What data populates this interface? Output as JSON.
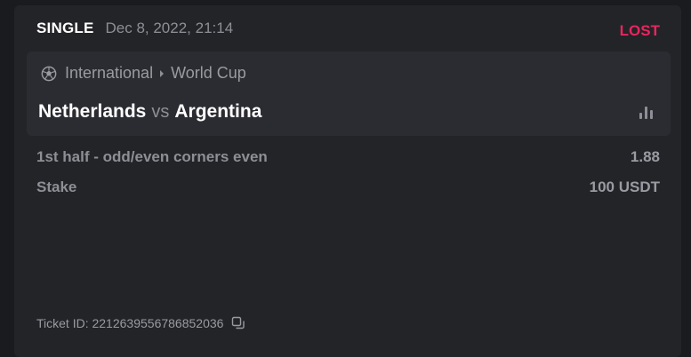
{
  "bet": {
    "type": "SINGLE",
    "date": "Dec 8, 2022, 21:14",
    "status": "LOST",
    "status_color": "#e8265e"
  },
  "event": {
    "sport_icon": "soccer-ball-icon",
    "category": "International",
    "league": "World Cup",
    "home_team": "Netherlands",
    "vs": "vs",
    "away_team": "Argentina",
    "stats_icon": "bar-chart-icon"
  },
  "selection": {
    "market": "1st half - odd/even corners even",
    "odds": "1.88"
  },
  "stake": {
    "label": "Stake",
    "value": "100 USDT"
  },
  "ticket": {
    "label": "Ticket ID: 2212639556786852036",
    "copy_icon": "copy-icon"
  }
}
